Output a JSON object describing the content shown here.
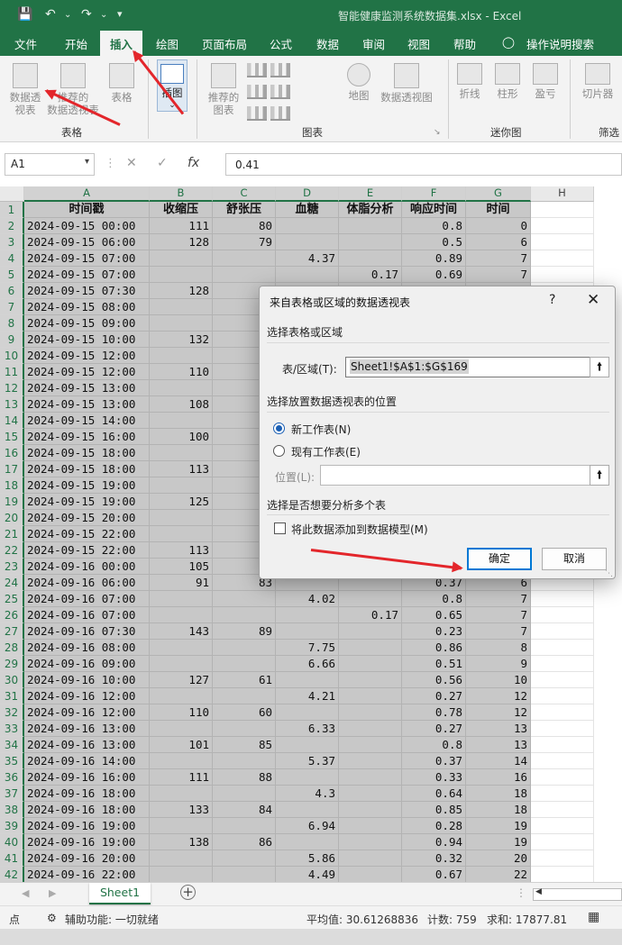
{
  "window": {
    "title": "智能健康监测系统数据集.xlsx  -  Excel"
  },
  "ribbon_tabs": [
    "文件",
    "开始",
    "插入",
    "绘图",
    "页面布局",
    "公式",
    "数据",
    "审阅",
    "视图",
    "帮助",
    "操作说明搜索"
  ],
  "active_tab": "插入",
  "ribbon": {
    "pivot_btn": "数据透\n视表",
    "recommended_pivot": "推荐的\n数据透视表",
    "table_btn": "表格",
    "illustrations_btn": "插图",
    "recommended_charts": "推荐的\n图表",
    "map_btn": "地图",
    "pivot_chart_btn": "数据透视图",
    "line_btn": "折线",
    "column_btn": "柱形",
    "winloss_btn": "盈亏",
    "slicer_btn": "切片器",
    "group_tables": "表格",
    "group_charts": "图表",
    "group_sparklines": "迷你图",
    "group_filter": "筛选"
  },
  "formula_bar": {
    "name_box": "A1",
    "formula": "0.41",
    "fx_label": "fx"
  },
  "columns": [
    "A",
    "B",
    "C",
    "D",
    "E",
    "F",
    "G",
    "H"
  ],
  "table": {
    "headers": [
      "时间戳",
      "收缩压",
      "舒张压",
      "血糖",
      "体脂分析",
      "响应时间",
      "时间"
    ],
    "rows": [
      [
        "2024-09-15 00:00",
        "111",
        "80",
        "",
        "",
        "0.8",
        "0"
      ],
      [
        "2024-09-15 06:00",
        "128",
        "79",
        "",
        "",
        "0.5",
        "6"
      ],
      [
        "2024-09-15 07:00",
        "",
        "",
        "4.37",
        "",
        "0.89",
        "7"
      ],
      [
        "2024-09-15 07:00",
        "",
        "",
        "",
        "0.17",
        "0.69",
        "7"
      ],
      [
        "2024-09-15 07:30",
        "128",
        "",
        "",
        "",
        "",
        ""
      ],
      [
        "2024-09-15 08:00",
        "",
        "",
        "",
        "",
        "",
        ""
      ],
      [
        "2024-09-15 09:00",
        "",
        "",
        "",
        "",
        "",
        ""
      ],
      [
        "2024-09-15 10:00",
        "132",
        "",
        "",
        "",
        "",
        ""
      ],
      [
        "2024-09-15 12:00",
        "",
        "",
        "",
        "",
        "",
        ""
      ],
      [
        "2024-09-15 12:00",
        "110",
        "",
        "",
        "",
        "",
        ""
      ],
      [
        "2024-09-15 13:00",
        "",
        "",
        "",
        "",
        "",
        ""
      ],
      [
        "2024-09-15 13:00",
        "108",
        "",
        "",
        "",
        "",
        ""
      ],
      [
        "2024-09-15 14:00",
        "",
        "",
        "",
        "",
        "",
        ""
      ],
      [
        "2024-09-15 16:00",
        "100",
        "",
        "",
        "",
        "",
        ""
      ],
      [
        "2024-09-15 18:00",
        "",
        "",
        "",
        "",
        "",
        ""
      ],
      [
        "2024-09-15 18:00",
        "113",
        "",
        "",
        "",
        "",
        ""
      ],
      [
        "2024-09-15 19:00",
        "",
        "",
        "",
        "",
        "",
        ""
      ],
      [
        "2024-09-15 19:00",
        "125",
        "",
        "",
        "",
        "",
        ""
      ],
      [
        "2024-09-15 20:00",
        "",
        "",
        "",
        "",
        "",
        ""
      ],
      [
        "2024-09-15 22:00",
        "",
        "",
        "",
        "",
        "",
        ""
      ],
      [
        "2024-09-15 22:00",
        "113",
        "",
        "",
        "",
        "",
        ""
      ],
      [
        "2024-09-16 00:00",
        "105",
        "",
        "",
        "",
        "",
        ""
      ],
      [
        "2024-09-16 06:00",
        "91",
        "83",
        "",
        "",
        "0.37",
        "6"
      ],
      [
        "2024-09-16 07:00",
        "",
        "",
        "4.02",
        "",
        "0.8",
        "7"
      ],
      [
        "2024-09-16 07:00",
        "",
        "",
        "",
        "0.17",
        "0.65",
        "7"
      ],
      [
        "2024-09-16 07:30",
        "143",
        "89",
        "",
        "",
        "0.23",
        "7"
      ],
      [
        "2024-09-16 08:00",
        "",
        "",
        "7.75",
        "",
        "0.86",
        "8"
      ],
      [
        "2024-09-16 09:00",
        "",
        "",
        "6.66",
        "",
        "0.51",
        "9"
      ],
      [
        "2024-09-16 10:00",
        "127",
        "61",
        "",
        "",
        "0.56",
        "10"
      ],
      [
        "2024-09-16 12:00",
        "",
        "",
        "4.21",
        "",
        "0.27",
        "12"
      ],
      [
        "2024-09-16 12:00",
        "110",
        "60",
        "",
        "",
        "0.78",
        "12"
      ],
      [
        "2024-09-16 13:00",
        "",
        "",
        "6.33",
        "",
        "0.27",
        "13"
      ],
      [
        "2024-09-16 13:00",
        "101",
        "85",
        "",
        "",
        "0.8",
        "13"
      ],
      [
        "2024-09-16 14:00",
        "",
        "",
        "5.37",
        "",
        "0.37",
        "14"
      ],
      [
        "2024-09-16 16:00",
        "111",
        "88",
        "",
        "",
        "0.33",
        "16"
      ],
      [
        "2024-09-16 18:00",
        "",
        "",
        "4.3",
        "",
        "0.64",
        "18"
      ],
      [
        "2024-09-16 18:00",
        "133",
        "84",
        "",
        "",
        "0.85",
        "18"
      ],
      [
        "2024-09-16 19:00",
        "",
        "",
        "6.94",
        "",
        "0.28",
        "19"
      ],
      [
        "2024-09-16 19:00",
        "138",
        "86",
        "",
        "",
        "0.94",
        "19"
      ],
      [
        "2024-09-16 20:00",
        "",
        "",
        "5.86",
        "",
        "0.32",
        "20"
      ],
      [
        "2024-09-16 22:00",
        "",
        "",
        "4.49",
        "",
        "0.67",
        "22"
      ]
    ]
  },
  "sheet_tab": "Sheet1",
  "status": {
    "mode": "点",
    "accessibility": "辅助功能: 一切就绪",
    "average": "平均值: 30.61268836",
    "count": "计数: 759",
    "sum": "求和: 17877.81"
  },
  "dialog": {
    "title": "来自表格或区域的数据透视表",
    "help": "?",
    "close": "✕",
    "section_range": "选择表格或区域",
    "range_label": "表/区域(T):",
    "range_value": "Sheet1!$A$1:$G$169",
    "section_location": "选择放置数据透视表的位置",
    "radio_new": "新工作表(N)",
    "radio_existing": "现有工作表(E)",
    "location_label": "位置(L):",
    "section_multi": "选择是否想要分析多个表",
    "checkbox_model": "将此数据添加到数据模型(M)",
    "ok": "确定",
    "cancel": "取消"
  },
  "colors": {
    "excel_green": "#217346",
    "arrow_red": "#e3262b",
    "ok_border": "#0078d4"
  }
}
